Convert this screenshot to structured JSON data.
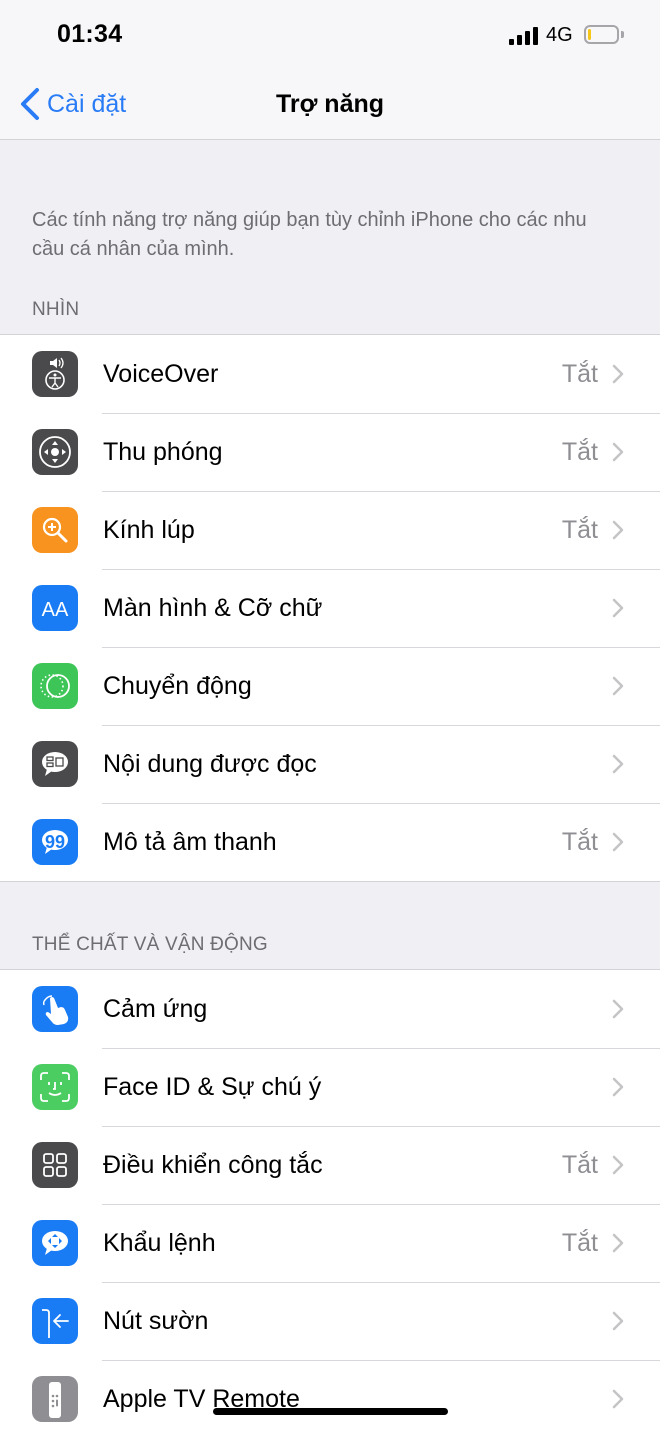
{
  "status_bar": {
    "time": "01:34",
    "network": "4G",
    "signal_bars": 4,
    "battery_percent": 10,
    "battery_color": "#f5c518"
  },
  "nav": {
    "back_label": "Cài đặt",
    "title": "Trợ năng"
  },
  "intro_text": "Các tính năng trợ năng giúp bạn tùy chỉnh iPhone cho các nhu cầu cá nhân của mình.",
  "sections": [
    {
      "header": "NHÌN",
      "items": [
        {
          "label": "VoiceOver",
          "value": "Tắt",
          "icon": "voiceover-icon",
          "icon_color": "#4a4a4c"
        },
        {
          "label": "Thu phóng",
          "value": "Tắt",
          "icon": "zoom-icon",
          "icon_color": "#4a4a4c"
        },
        {
          "label": "Kính lúp",
          "value": "Tắt",
          "icon": "magnifier-icon",
          "icon_color": "#f7931e"
        },
        {
          "label": "Màn hình & Cỡ chữ",
          "value": "",
          "icon": "display-text-size-icon",
          "icon_color": "#1a7cf5"
        },
        {
          "label": "Chuyển động",
          "value": "",
          "icon": "motion-icon",
          "icon_color": "#3ec557"
        },
        {
          "label": "Nội dung được đọc",
          "value": "",
          "icon": "spoken-content-icon",
          "icon_color": "#4a4a4c"
        },
        {
          "label": "Mô tả âm thanh",
          "value": "Tắt",
          "icon": "audio-descriptions-icon",
          "icon_color": "#1a7cf5"
        }
      ]
    },
    {
      "header": "THỂ CHẤT VÀ VẬN ĐỘNG",
      "items": [
        {
          "label": "Cảm ứng",
          "value": "",
          "icon": "touch-icon",
          "icon_color": "#1a7cf5"
        },
        {
          "label": "Face ID & Sự chú ý",
          "value": "",
          "icon": "face-id-icon",
          "icon_color": "#4ccd62"
        },
        {
          "label": "Điều khiển công tắc",
          "value": "Tắt",
          "icon": "switch-control-icon",
          "icon_color": "#4a4a4c"
        },
        {
          "label": "Khẩu lệnh",
          "value": "Tắt",
          "icon": "voice-control-icon",
          "icon_color": "#1a7cf5"
        },
        {
          "label": "Nút sườn",
          "value": "",
          "icon": "side-button-icon",
          "icon_color": "#1a7cf5"
        },
        {
          "label": "Apple TV Remote",
          "value": "",
          "icon": "apple-tv-remote-icon",
          "icon_color": "#8e8e93"
        }
      ]
    }
  ]
}
